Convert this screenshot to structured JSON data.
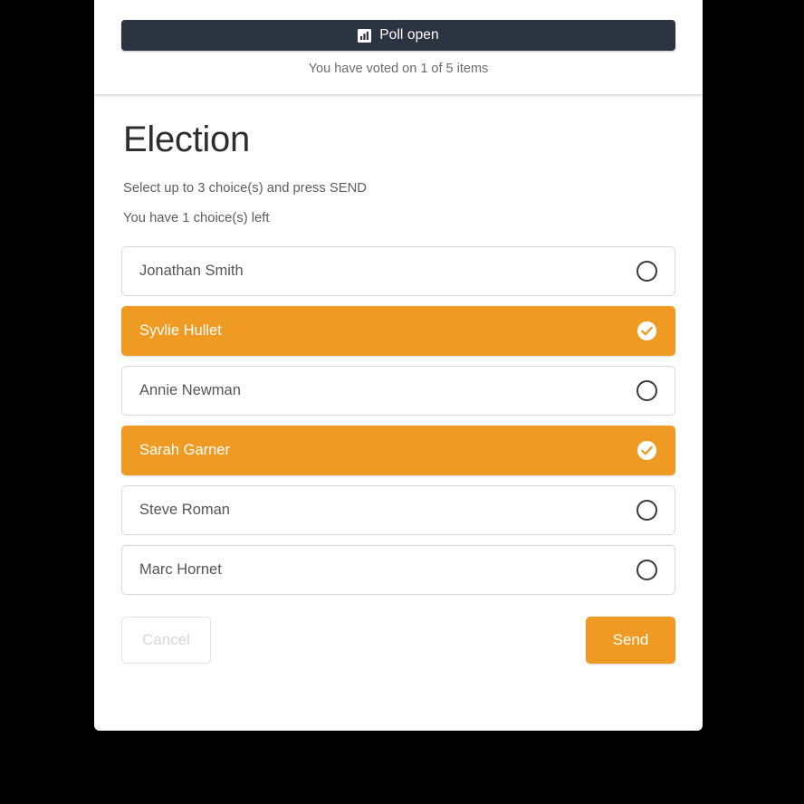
{
  "theme": {
    "accent_orange": "#ef9a23",
    "header_dark": "#2b3440",
    "page_background": "#000000",
    "card_background": "#ffffff"
  },
  "header": {
    "status_icon": "bar-chart-icon",
    "status_label": "Poll open",
    "voted_summary": "You have voted on 1 of 5 items"
  },
  "poll": {
    "title": "Election",
    "instruction_select": "Select up to 3 choice(s) and press SEND",
    "instruction_left": "You have 1 choice(s) left",
    "max_choices": 3,
    "choices_left": 1,
    "items": [
      {
        "label": "Jonathan Smith",
        "selected": false,
        "icon": "radio-empty-icon"
      },
      {
        "label": "Syvlie Hullet",
        "selected": true,
        "icon": "check-circle-icon"
      },
      {
        "label": "Annie Newman",
        "selected": false,
        "icon": "radio-empty-icon"
      },
      {
        "label": "Sarah Garner",
        "selected": true,
        "icon": "check-circle-icon"
      },
      {
        "label": "Steve Roman",
        "selected": false,
        "icon": "radio-empty-icon"
      },
      {
        "label": "Marc Hornet",
        "selected": false,
        "icon": "radio-empty-icon"
      }
    ]
  },
  "actions": {
    "cancel_label": "Cancel",
    "cancel_disabled": true,
    "send_label": "Send"
  }
}
